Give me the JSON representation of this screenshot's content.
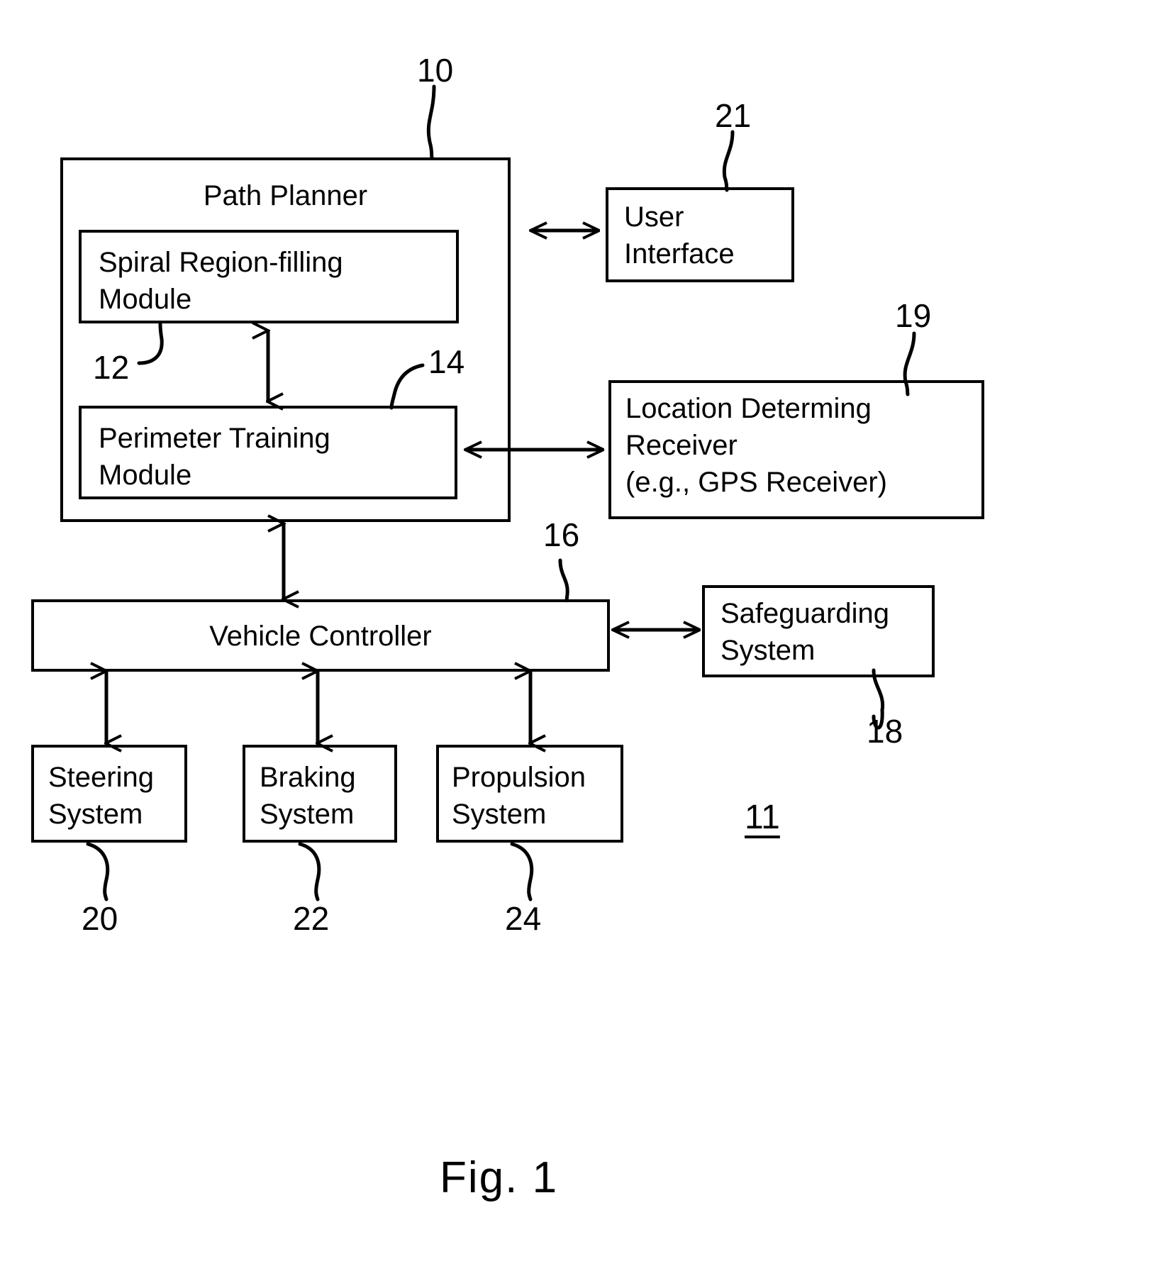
{
  "figure": {
    "title": "Fig. 1",
    "system_ref": "11"
  },
  "boxes": {
    "path_planner": {
      "label": "Path Planner",
      "ref": "10"
    },
    "spiral_module": {
      "label": "Spiral Region-filling\nModule",
      "ref": "12"
    },
    "perimeter_module": {
      "label": "Perimeter Training\nModule",
      "ref": "14"
    },
    "user_interface": {
      "label": "User\nInterface",
      "ref": "21"
    },
    "location_receiver": {
      "label": "Location Determing\nReceiver\n(e.g., GPS Receiver)",
      "ref": "19"
    },
    "vehicle_controller": {
      "label": "Vehicle Controller",
      "ref": "16"
    },
    "safeguarding_system": {
      "label": "Safeguarding\nSystem",
      "ref": "18"
    },
    "steering_system": {
      "label": "Steering\nSystem",
      "ref": "20"
    },
    "braking_system": {
      "label": "Braking\nSystem",
      "ref": "22"
    },
    "propulsion_system": {
      "label": "Propulsion\nSystem",
      "ref": "24"
    }
  },
  "colors": {
    "ink": "#000000",
    "paper": "#ffffff"
  }
}
